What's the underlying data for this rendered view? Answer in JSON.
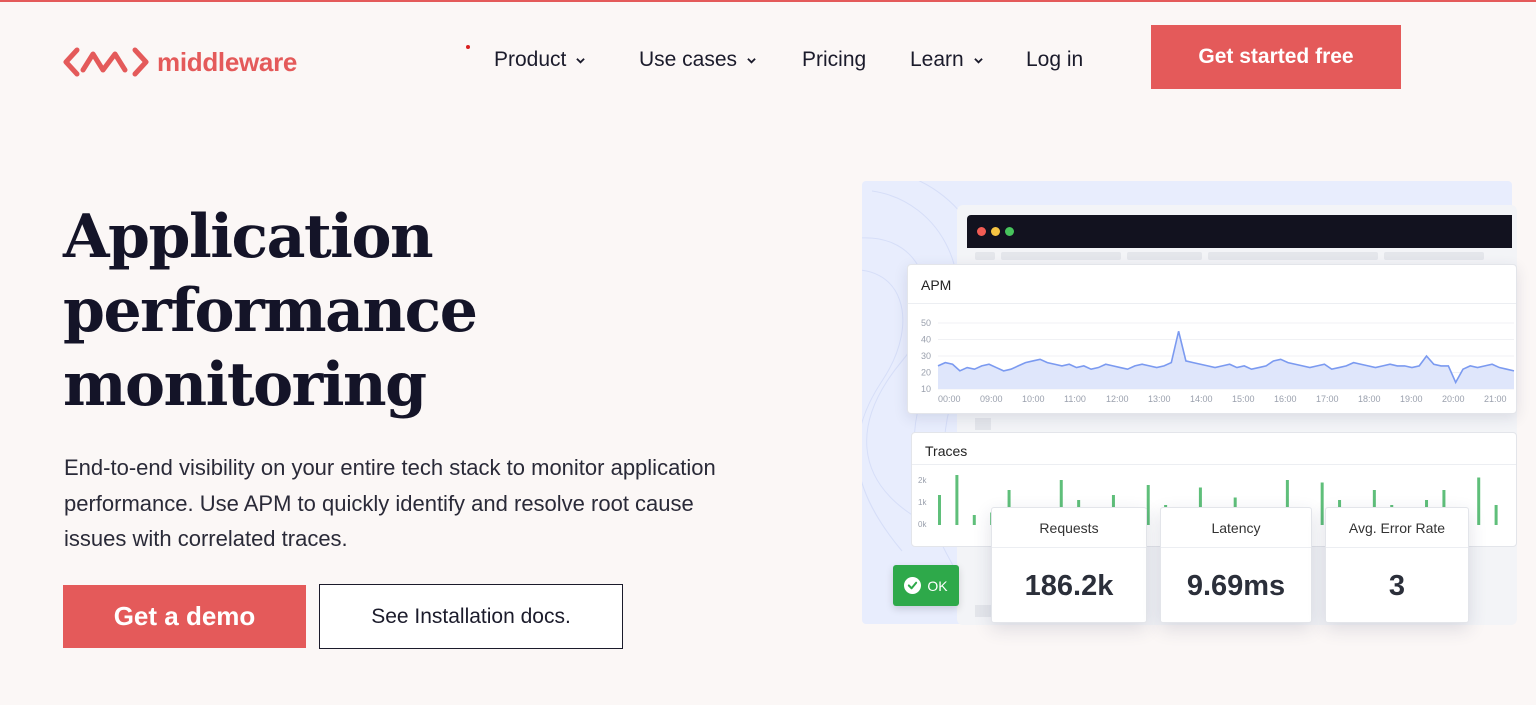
{
  "brand": {
    "name": "middleware",
    "accent": "#e45a5a"
  },
  "nav": {
    "items": [
      {
        "label": "Product",
        "has_dropdown": true
      },
      {
        "label": "Use cases",
        "has_dropdown": true
      },
      {
        "label": "Pricing",
        "has_dropdown": false
      },
      {
        "label": "Learn",
        "has_dropdown": true
      },
      {
        "label": "Log in",
        "has_dropdown": false
      }
    ],
    "cta": "Get started free"
  },
  "hero": {
    "title_line1": "Application",
    "title_line2": "performance",
    "title_line3": "monitoring",
    "description": "End-to-end visibility on your entire tech stack to monitor application performance. Use APM to quickly identify and resolve root cause issues with correlated traces.",
    "primary_button": "Get a demo",
    "secondary_button": "See Installation docs."
  },
  "dashboard": {
    "apm_title": "APM",
    "apm_y_ticks": [
      "50",
      "40",
      "30",
      "20",
      "10"
    ],
    "apm_x_ticks": [
      "00:00",
      "09:00",
      "10:00",
      "11:00",
      "12:00",
      "13:00",
      "14:00",
      "15:00",
      "16:00",
      "17:00",
      "18:00",
      "19:00",
      "20:00",
      "21:00"
    ],
    "apm_series": [
      24,
      26,
      25,
      21,
      23,
      22,
      24,
      25,
      23,
      21,
      22,
      24,
      26,
      27,
      28,
      26,
      25,
      24,
      25,
      23,
      24,
      22,
      23,
      25,
      24,
      23,
      22,
      24,
      25,
      24,
      23,
      24,
      26,
      45,
      27,
      26,
      25,
      24,
      23,
      24,
      25,
      23,
      24,
      22,
      23,
      24,
      27,
      28,
      26,
      25,
      24,
      23,
      24,
      25,
      22,
      23,
      24,
      26,
      25,
      24,
      23,
      24,
      25,
      24,
      24,
      23,
      24,
      30,
      25,
      24,
      24,
      14,
      22,
      24,
      23,
      24,
      25,
      23,
      22,
      21
    ],
    "traces_title": "Traces",
    "traces_y_ticks": [
      "2k",
      "1k",
      "0k"
    ],
    "traces_bars": [
      0.6,
      1.0,
      0.2,
      0.25,
      0.7,
      0.1,
      0.2,
      0.9,
      0.5,
      0.3,
      0.6,
      0.2,
      0.8,
      0.4,
      0.25,
      0.75,
      0.2,
      0.55,
      0.3,
      0.2,
      0.9,
      0.2,
      0.85,
      0.5,
      0.25,
      0.7,
      0.4,
      0.2,
      0.5,
      0.7,
      0.2,
      0.95,
      0.4
    ],
    "metrics": [
      {
        "label": "Requests",
        "value": "186.2k"
      },
      {
        "label": "Latency",
        "value": "9.69ms"
      },
      {
        "label": "Avg. Error Rate",
        "value": "3"
      }
    ],
    "status": "OK",
    "colors": {
      "line": "#7b9af0",
      "area": "#dfe6fb",
      "bars": "#5fbf7a",
      "ok": "#2ea94a",
      "titlebar": "#12121f"
    }
  }
}
